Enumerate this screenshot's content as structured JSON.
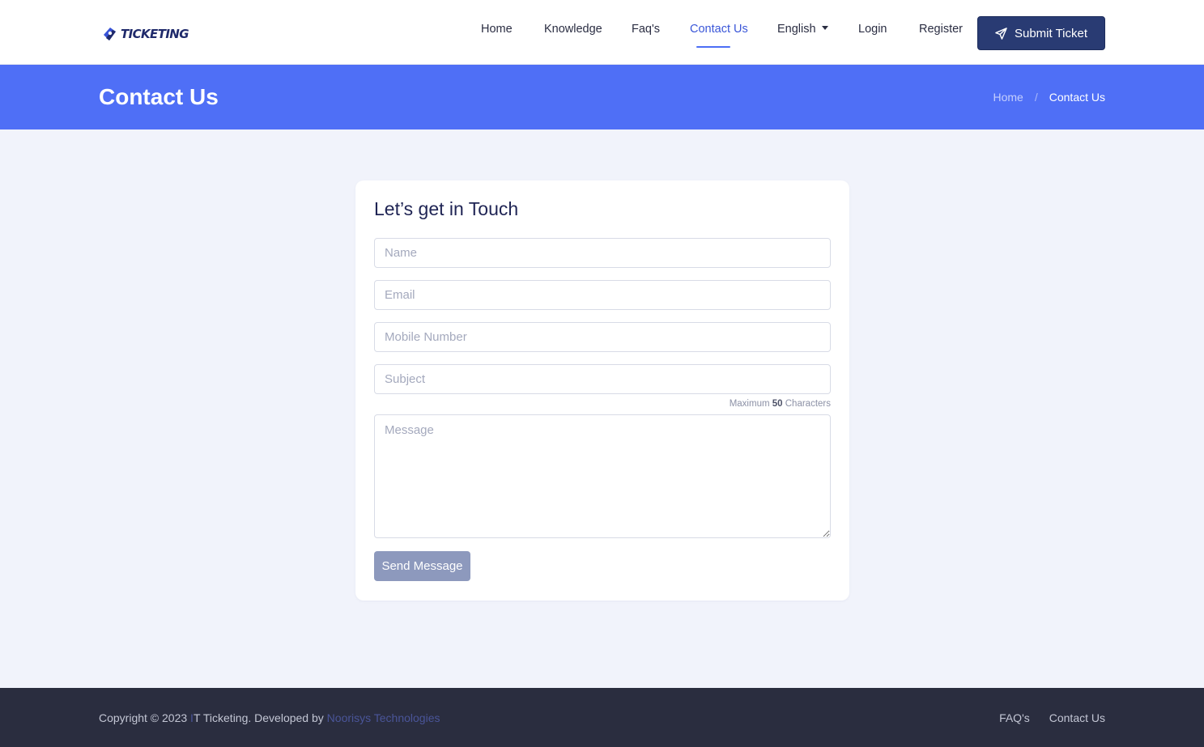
{
  "brand": {
    "name": "TICKETING"
  },
  "nav": {
    "items": [
      {
        "label": "Home"
      },
      {
        "label": "Knowledge"
      },
      {
        "label": "Faq's"
      },
      {
        "label": "Contact Us"
      },
      {
        "label": "English"
      },
      {
        "label": "Login"
      },
      {
        "label": "Register"
      }
    ],
    "active": "Contact Us",
    "submit_label": "Submit Ticket",
    "submit_icon": "paper-plane-icon"
  },
  "banner": {
    "title": "Contact Us",
    "breadcrumb": {
      "home": "Home",
      "separator": "/",
      "current": "Contact Us"
    }
  },
  "form": {
    "title": "Let’s get in Touch",
    "name_placeholder": "Name",
    "email_placeholder": "Email",
    "mobile_placeholder": "Mobile Number",
    "subject_placeholder": "Subject",
    "hint_prefix": "Maximum",
    "hint_count": "50",
    "hint_suffix": "Characters",
    "message_placeholder": "Message",
    "send_label": "Send Message"
  },
  "footer": {
    "copyright_prefix": "Copyright © 2023",
    "accent_char": "I",
    "copyright_middle": "T Ticketing. Developed by",
    "developer": "Noorisys Technologies",
    "links": [
      {
        "label": "FAQ's"
      },
      {
        "label": "Contact Us"
      }
    ]
  },
  "colors": {
    "banner": "#4f6ff6",
    "active_nav": "#3a56d8",
    "submit_button": "#293b73",
    "send_button": "#8d99bd",
    "footer": "#2a2d3f"
  }
}
